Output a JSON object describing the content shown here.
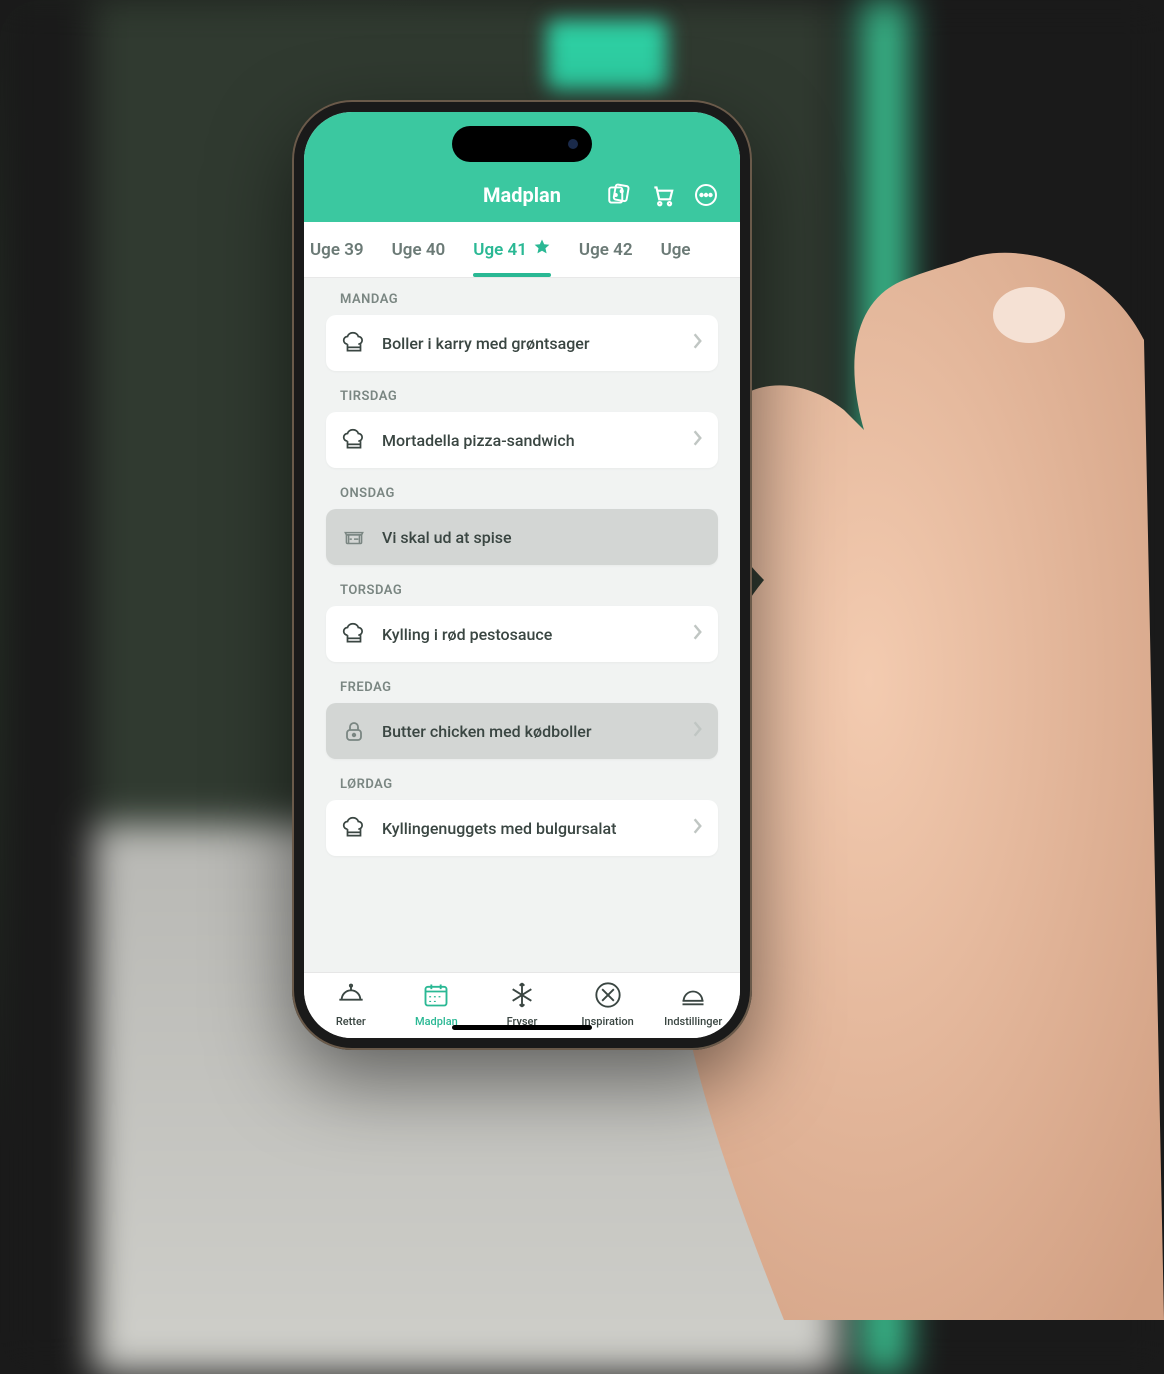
{
  "header": {
    "title": "Madplan"
  },
  "weeks": [
    {
      "label": "Uge 39",
      "active": false,
      "starred": false
    },
    {
      "label": "Uge 40",
      "active": false,
      "starred": false
    },
    {
      "label": "Uge 41",
      "active": true,
      "starred": true
    },
    {
      "label": "Uge 42",
      "active": false,
      "starred": false
    },
    {
      "label": "Uge",
      "active": false,
      "starred": false
    }
  ],
  "days": [
    {
      "day": "MANDAG",
      "meal": "Boller i karry med grøntsager",
      "icon": "chef-hat",
      "muted": false,
      "chevron": true
    },
    {
      "day": "TIRSDAG",
      "meal": "Mortadella pizza-sandwich",
      "icon": "chef-hat",
      "muted": false,
      "chevron": true
    },
    {
      "day": "ONSDAG",
      "meal": "Vi skal ud at spise",
      "icon": "restaurant",
      "muted": true,
      "chevron": false
    },
    {
      "day": "TORSDAG",
      "meal": "Kylling i rød pestosauce",
      "icon": "chef-hat",
      "muted": false,
      "chevron": true
    },
    {
      "day": "FREDAG",
      "meal": "Butter chicken med kødboller",
      "icon": "lock",
      "muted": true,
      "chevron": true
    },
    {
      "day": "LØRDAG",
      "meal": "Kyllingenuggets med bulgursalat",
      "icon": "chef-hat",
      "muted": false,
      "chevron": true
    }
  ],
  "nav": [
    {
      "label": "Retter",
      "icon": "dish",
      "active": false
    },
    {
      "label": "Madplan",
      "icon": "calendar",
      "active": true
    },
    {
      "label": "Fryser",
      "icon": "snowflake",
      "active": false
    },
    {
      "label": "Inspiration",
      "icon": "utensils",
      "active": false
    },
    {
      "label": "Indstillinger",
      "icon": "settings",
      "active": false
    }
  ],
  "colors": {
    "accent": "#3bc8a0",
    "accent_dark": "#2ab894"
  }
}
